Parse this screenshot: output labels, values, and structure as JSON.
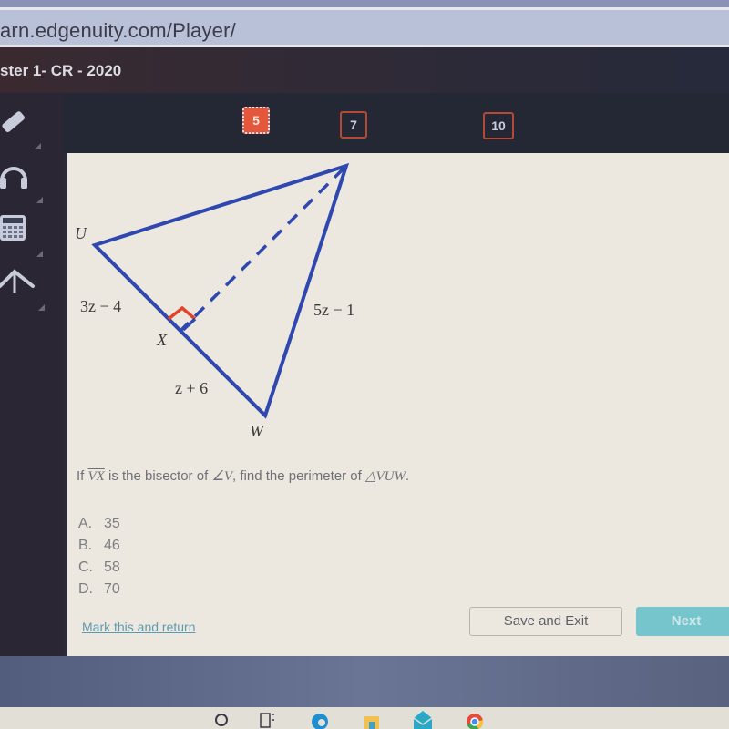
{
  "browser": {
    "url": "arn.edgenuity.com/Player/"
  },
  "header": {
    "course_title": "ster 1- CR - 2020"
  },
  "question_nav": {
    "items": [
      {
        "label": "5",
        "state": "active"
      },
      {
        "label": "7",
        "state": "unanswered"
      },
      {
        "label": "10",
        "state": "unanswered"
      }
    ]
  },
  "sidebar": {
    "tools": [
      {
        "name": "pencil-icon"
      },
      {
        "name": "headphones-icon"
      },
      {
        "name": "calculator-icon"
      },
      {
        "name": "compass-icon"
      }
    ]
  },
  "diagram": {
    "vertices": {
      "U": "U",
      "X": "X",
      "W": "W"
    },
    "side_labels": {
      "ux": "3z − 4",
      "xw": "z + 6",
      "vw": "5z − 1"
    },
    "colors": {
      "triangle": "#2e48b0",
      "right_angle": "#e0452c"
    }
  },
  "question": {
    "prefix": "If ",
    "segment": "VX",
    "middle": " is the bisector of ",
    "angle": "∠V",
    "suffix_text": ", find the perimeter of ",
    "triangle": "△VUW",
    "end": "."
  },
  "choices": [
    {
      "letter": "A.",
      "value": "35"
    },
    {
      "letter": "B.",
      "value": "46"
    },
    {
      "letter": "C.",
      "value": "58"
    },
    {
      "letter": "D.",
      "value": "70"
    }
  ],
  "footer": {
    "mark_link": "Mark this and return",
    "save_exit": "Save and Exit",
    "next": "Next"
  },
  "taskbar": {
    "icons": [
      "search-icon",
      "task-view-icon",
      "edge-icon",
      "file-explorer-icon",
      "mail-icon",
      "chrome-icon"
    ]
  },
  "colors": {
    "accent_active": "#e4573b",
    "next_button": "#76c4cc",
    "link": "#5d9bb0"
  }
}
